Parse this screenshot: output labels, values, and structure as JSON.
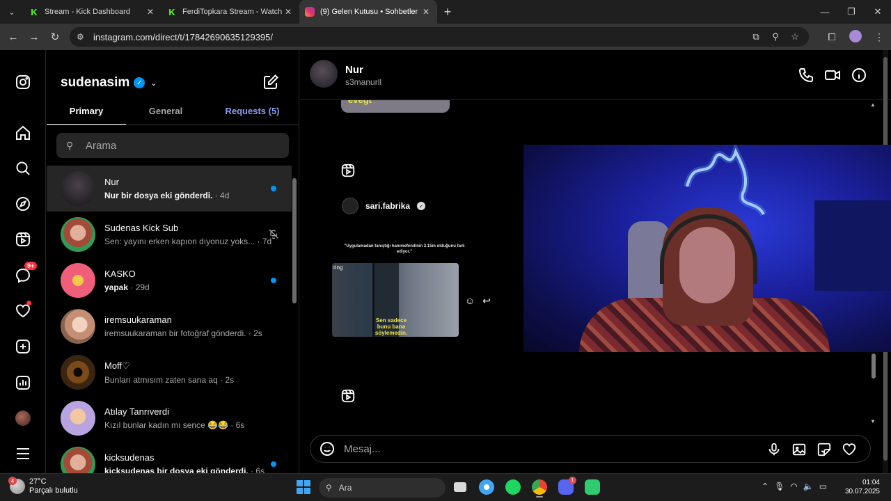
{
  "browser": {
    "tabs": [
      {
        "title": "Stream - Kick Dashboard",
        "icon": "kick-icon"
      },
      {
        "title": "FerdiTopkara Stream - Watch Li",
        "icon": "kick-icon"
      },
      {
        "title": "(9) Gelen Kutusu • Sohbetler",
        "icon": "instagram-icon"
      }
    ],
    "url": "instagram.com/direct/t/17842690635129395/"
  },
  "rail": {
    "messages_badge": "9+"
  },
  "inbox": {
    "account": "sudenasim",
    "tabs": {
      "primary": "Primary",
      "general": "General",
      "requests": "Requests (5)"
    },
    "search_placeholder": "Arama",
    "threads": [
      {
        "name": "Nur",
        "preview": "Nur bir dosya eki gönderdi.",
        "time": " · 4d",
        "unread": true,
        "selected": true
      },
      {
        "name": "Sudenas Kick Sub",
        "preview": "Sen: yayını erken kapıon dıyonuz yoks...",
        "time": " · 7d",
        "muted": true
      },
      {
        "name": "KASKO",
        "preview": "yapak",
        "time": " · 29d",
        "unread": true
      },
      {
        "name": "iremsuukaraman",
        "preview": "iremsuukaraman bir fotoğraf gönderdi.",
        "time": " · 2s"
      },
      {
        "name": "Moff♡",
        "preview": "Bunları atmısım zaten sana aq",
        "time": " · 2s"
      },
      {
        "name": "Atılay Tanrıverdi",
        "preview": "Kızıl bunlar kadın mı sence 😂😂",
        "time": " · 6s"
      },
      {
        "name": "kicksudenas",
        "preview": "kicksudenas bir dosya eki gönderdi.",
        "time": " · 6s",
        "unread": true
      }
    ]
  },
  "conversation": {
    "name": "Nur",
    "username": "s3manurll",
    "top_media_text": "evegt",
    "shared_by": "sari.fabrika",
    "reel_caption": "\"Uygulamadan tanıştığı hanımefendinin 2.15m olduğunu fark ediyor.\"",
    "reel_corner": "ring",
    "reel_subtitle": "Sen sadece bunu bana söylemedin.",
    "composer_placeholder": "Mesaj..."
  },
  "taskbar": {
    "weather_temp": "27°C",
    "weather_desc": "Parçalı bulutlu",
    "weather_badge": "4",
    "search": "Ara",
    "discord_badge": "1",
    "time": "01:04",
    "date": "30.07.2025"
  }
}
